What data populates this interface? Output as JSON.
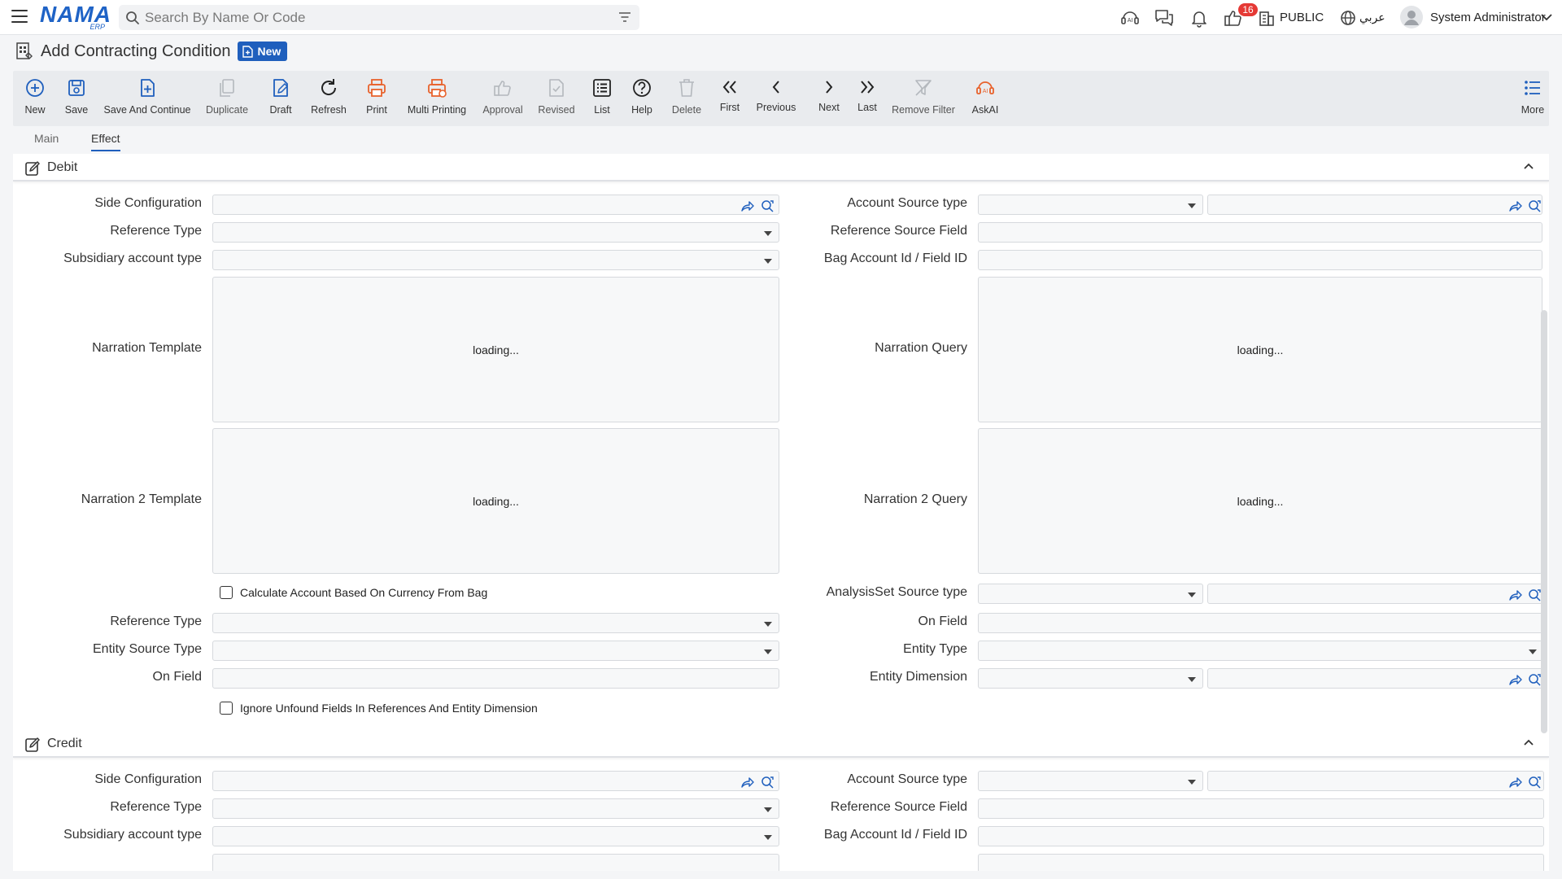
{
  "topbar": {
    "logo_main": "NAMA",
    "logo_sub": "ERP",
    "search_placeholder": "Search By Name Or Code",
    "notification_count": "16",
    "public_label": "PUBLIC",
    "language_label": "عربي",
    "user_name": "System Administrator"
  },
  "page": {
    "title": "Add Contracting Condition",
    "status_badge": "New"
  },
  "toolbar": {
    "new": "New",
    "save": "Save",
    "save_continue": "Save And Continue",
    "duplicate": "Duplicate",
    "draft": "Draft",
    "refresh": "Refresh",
    "print": "Print",
    "multi_printing": "Multi Printing",
    "approval": "Approval",
    "revised": "Revised",
    "list": "List",
    "help": "Help",
    "delete": "Delete",
    "first": "First",
    "previous": "Previous",
    "next": "Next",
    "last": "Last",
    "remove_filter": "Remove Filter",
    "askai": "AskAI",
    "more": "More"
  },
  "tabs": {
    "main": "Main",
    "effect": "Effect"
  },
  "debit": {
    "title": "Debit",
    "side_configuration": "Side Configuration",
    "reference_type": "Reference Type",
    "subsidiary_account_type": "Subsidiary account type",
    "narration_template": "Narration Template",
    "narration2_template": "Narration 2 Template",
    "calc_account_currency": "Calculate Account Based On Currency From Bag",
    "reference_type2": "Reference Type",
    "entity_source_type": "Entity Source Type",
    "on_field": "On Field",
    "ignore_unfound": "Ignore Unfound Fields In References And Entity Dimension",
    "account_source_type": "Account Source type",
    "reference_source_field": "Reference Source Field",
    "bag_account_id": "Bag Account Id / Field ID",
    "narration_query": "Narration Query",
    "narration2_query": "Narration 2 Query",
    "analysis_set_source_type": "AnalysisSet Source type",
    "on_field_right": "On Field",
    "entity_type": "Entity Type",
    "entity_dimension": "Entity Dimension",
    "loading": "loading..."
  },
  "credit": {
    "title": "Credit",
    "side_configuration": "Side Configuration",
    "reference_type": "Reference Type",
    "subsidiary_account_type": "Subsidiary account type",
    "account_source_type": "Account Source type",
    "reference_source_field": "Reference Source Field",
    "bag_account_id": "Bag Account Id / Field ID"
  },
  "colors": {
    "brand": "#1f63c6",
    "accent": "#1f5fbd",
    "print": "#e8622c",
    "badge": "#e53935"
  }
}
